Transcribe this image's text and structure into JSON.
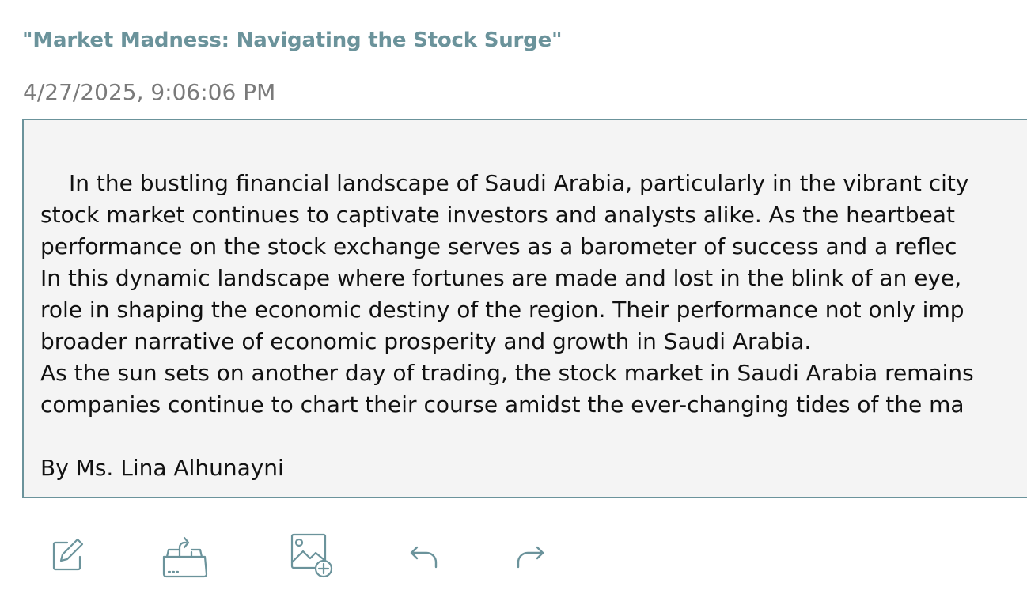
{
  "post": {
    "title": "\"Market Madness: Navigating the Stock Surge\"",
    "timestamp": "4/27/2025, 9:06:06 PM",
    "body_lines": [
      "In the bustling financial landscape of Saudi Arabia, particularly in the vibrant city",
      "stock market continues to captivate investors and analysts alike. As the heartbeat",
      "performance on the stock exchange serves as a barometer of success and a reflec",
      "In this dynamic landscape where fortunes are made and lost in the blink of an eye,",
      "role in shaping the economic destiny of the region. Their performance not only imp",
      "broader narrative of economic prosperity and growth in Saudi Arabia.",
      "As the sun sets on another day of trading, the stock market in Saudi Arabia remains",
      "companies continue to chart their course amidst the ever-changing tides of the ma"
    ],
    "byline": "By Ms. Lina Alhunayni"
  },
  "toolbar": {
    "icons": [
      "edit-icon",
      "share-upload-icon",
      "add-image-icon",
      "undo-icon",
      "redo-icon"
    ],
    "accent_color": "#6b939b"
  },
  "colors": {
    "title": "#6b939b",
    "timestamp": "#7a7a7a",
    "box_border": "#6b939b",
    "box_background": "#f4f4f4",
    "text": "#111111"
  }
}
